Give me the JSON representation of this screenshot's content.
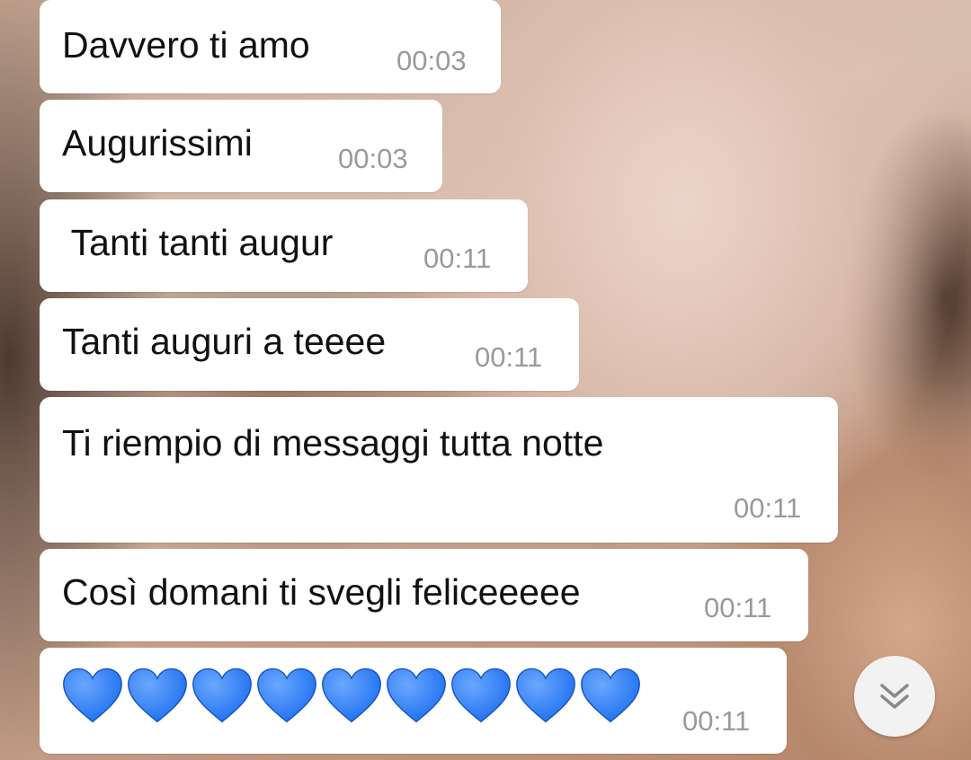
{
  "messages": [
    {
      "text": "Davvero ti amo",
      "time": "00:03"
    },
    {
      "text": "Augurissimi",
      "time": "00:03"
    },
    {
      "text": " Tanti tanti augur",
      "time": "00:11"
    },
    {
      "text": "Tanti auguri a teeee",
      "time": "00:11"
    },
    {
      "text": "Ti riempio di messaggi tutta notte",
      "time": "00:11"
    },
    {
      "text": "Così domani ti svegli feliceeeee",
      "time": "00:11"
    },
    {
      "text": "💙💙💙💙💙💙💙💙💙",
      "time": "00:11"
    }
  ],
  "colors": {
    "bubble": "#ffffff",
    "text": "#111111",
    "timestamp": "#9a9a9a",
    "heart": "#1e6ff0"
  },
  "icons": {
    "heart": "blue-heart-icon",
    "scroll": "double-chevron-down-icon"
  }
}
